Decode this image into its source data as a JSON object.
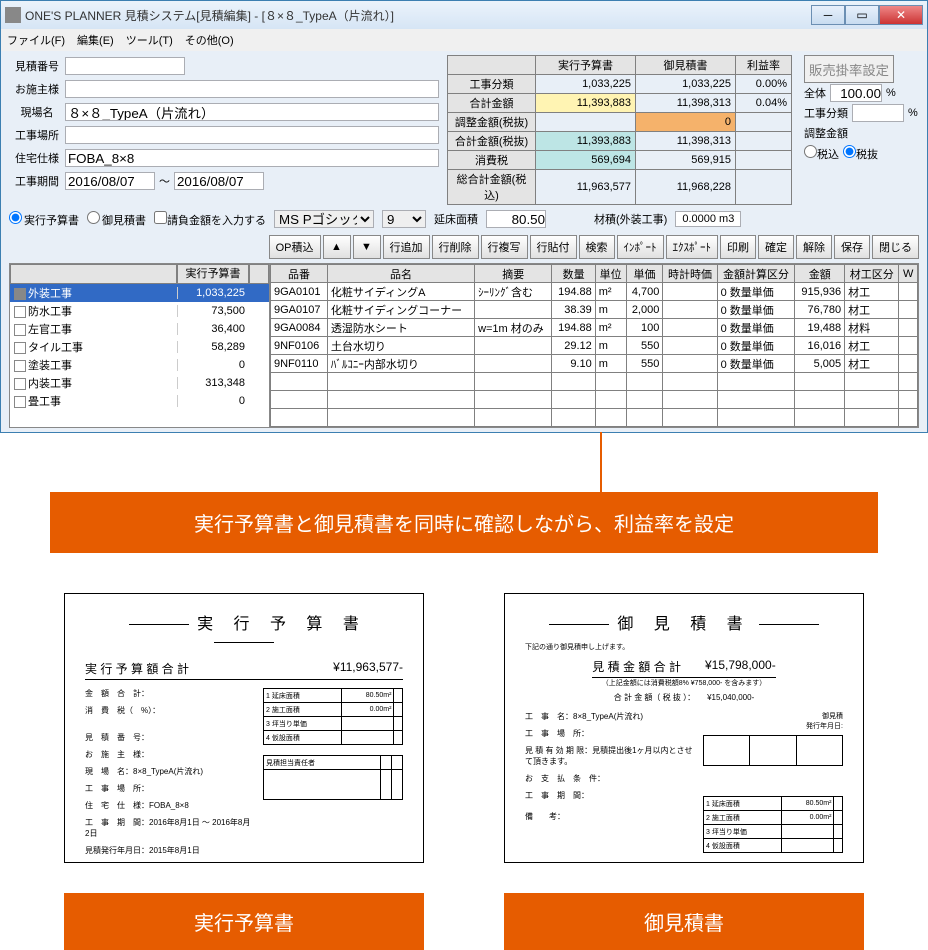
{
  "window": {
    "title": "ONE'S PLANNER 見積システム[見積編集] - [８×８_TypeA（片流れ）]"
  },
  "menu": [
    "ファイル(F)",
    "編集(E)",
    "ツール(T)",
    "その他(O)"
  ],
  "form": {
    "estimate_no_label": "見積番号",
    "estimate_no": "",
    "client_label": "お施主様",
    "client": "",
    "site_name_label": "現場名",
    "site_name": "８×８_TypeA（片流れ）",
    "site_place_label": "工事場所",
    "site_place": "",
    "spec_label": "住宅仕様",
    "spec": "FOBA_8×8",
    "period_label": "工事期間",
    "period_from": "2016/08/07",
    "period_sep": "～",
    "period_to": "2016/08/07"
  },
  "summary": {
    "columns": [
      "",
      "実行予算書",
      "御見積書",
      "利益率"
    ],
    "rows": [
      {
        "label": "工事分類",
        "a": "1,033,225",
        "b": "1,033,225",
        "c": "0.00%"
      },
      {
        "label": "合計金額",
        "a": "11,393,883",
        "b": "11,398,313",
        "c": "0.04%",
        "hl_a": "bg-yellow"
      },
      {
        "label": "調整金額(税抜)",
        "a": "",
        "b": "0",
        "c": "",
        "hl_b": "bg-orange"
      },
      {
        "label": "合計金額(税抜)",
        "a": "11,393,883",
        "b": "11,398,313",
        "c": "",
        "hl_a": "bg-cyan"
      },
      {
        "label": "消費税",
        "a": "569,694",
        "b": "569,915",
        "c": "",
        "hl_a": "bg-cyan"
      },
      {
        "label": "総合計金額(税込)",
        "a": "11,963,577",
        "b": "11,968,228",
        "c": ""
      }
    ]
  },
  "right": {
    "sales_alloc_btn": "販売掛率設定",
    "all_label": "全体",
    "all_val": "100.00",
    "pct": "%",
    "cat_label": "工事分類",
    "cat_val": "",
    "adj_label": "調整金額",
    "radio_taxin": "税込",
    "radio_taxout": "税抜"
  },
  "doc_type_row": {
    "opt1": "実行予算書",
    "opt2": "御見積書",
    "chk_label": "請負金額を入力する",
    "font_options": [
      "MS Pゴシック"
    ],
    "size_options": [
      "9"
    ],
    "floor_label": "延床面積",
    "floor_val": "80.50",
    "timber_label": "材積(外装工事)",
    "timber_val": "0.0000 m3"
  },
  "toolbar": [
    "OP積込",
    "▲",
    "▼",
    "行追加",
    "行削除",
    "行複写",
    "行貼付",
    "検索",
    "ｲﾝﾎﾟｰﾄ",
    "ｴｸｽﾎﾟｰﾄ",
    "印刷",
    "確定",
    "解除",
    "保存",
    "閉じる"
  ],
  "tree": {
    "headers": [
      "",
      "実行予算書",
      ""
    ],
    "rows": [
      {
        "name": "外装工事",
        "amt": "1,033,225",
        "mk": "",
        "selected": true
      },
      {
        "name": "防水工事",
        "amt": "73,500",
        "mk": ""
      },
      {
        "name": "左官工事",
        "amt": "36,400",
        "mk": ""
      },
      {
        "name": "タイル工事",
        "amt": "58,289",
        "mk": ""
      },
      {
        "name": "塗装工事",
        "amt": "0",
        "mk": ""
      },
      {
        "name": "内装工事",
        "amt": "313,348",
        "mk": ""
      },
      {
        "name": "畳工事",
        "amt": "0",
        "mk": ""
      }
    ]
  },
  "grid": {
    "headers": [
      "品番",
      "品名",
      "摘要",
      "数量",
      "単位",
      "単価",
      "時計時価",
      "金額計算区分",
      "金額",
      "材工区分",
      "W"
    ],
    "rows": [
      {
        "c": [
          "9GA0101",
          "化粧サイディングA",
          "ｼｰﾘﾝｸﾞ含む",
          "194.88",
          "m²",
          "4,700",
          "",
          "0 数量単価",
          "915,936",
          "材工",
          ""
        ]
      },
      {
        "c": [
          "9GA0107",
          "化粧サイディングコーナー",
          "",
          "38.39",
          "m",
          "2,000",
          "",
          "0 数量単価",
          "76,780",
          "材工",
          ""
        ]
      },
      {
        "c": [
          "9GA0084",
          "透湿防水シート",
          "w=1m 材のみ",
          "194.88",
          "m²",
          "100",
          "",
          "0 数量単価",
          "19,488",
          "材料",
          ""
        ]
      },
      {
        "c": [
          "9NF0106",
          "土台水切り",
          "",
          "29.12",
          "m",
          "550",
          "",
          "0 数量単価",
          "16,016",
          "材工",
          ""
        ]
      },
      {
        "c": [
          "9NF0110",
          "ﾊﾞﾙｺﾆｰ内部水切り",
          "",
          "9.10",
          "m",
          "550",
          "",
          "0 数量単価",
          "5,005",
          "材工",
          ""
        ]
      }
    ]
  },
  "callout": "実行予算書と御見積書を同時に確認しながら、利益率を設定",
  "preview1": {
    "title": "実 行 予 算 書",
    "subtotal_label": "実 行 予 算 額 合 計",
    "subtotal_amount": "¥11,963,577-",
    "label": "実行予算書"
  },
  "preview2": {
    "title": "御 見 積 書",
    "subtotal_label": "見 積 金 額 合 計",
    "subtotal_amount": "¥15,798,000-",
    "label": "御見積書"
  }
}
